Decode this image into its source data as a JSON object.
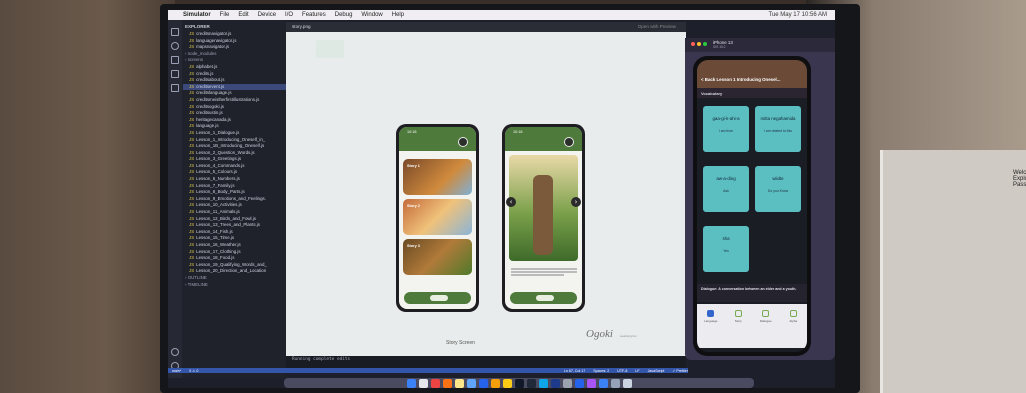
{
  "menubar": {
    "app": "Simulator",
    "items": [
      "File",
      "Edit",
      "Device",
      "I/O",
      "Features",
      "Debug",
      "Window",
      "Help"
    ],
    "clock": "Tue May 17 10:56 AM"
  },
  "explorer": {
    "title": "EXPLORER",
    "files": [
      {
        "kind": "file",
        "label": "creditsnavigator.js"
      },
      {
        "kind": "file",
        "label": "languagenavigator.js"
      },
      {
        "kind": "file",
        "label": "mapsnavigator.js"
      },
      {
        "kind": "folder",
        "label": "node_modules"
      },
      {
        "kind": "folder",
        "label": "screens"
      },
      {
        "kind": "file",
        "label": "alphabet.js"
      },
      {
        "kind": "file",
        "label": "credits.js"
      },
      {
        "kind": "file",
        "label": "creditsabout.js"
      },
      {
        "kind": "file",
        "label": "creditsevent.js",
        "selected": true
      },
      {
        "kind": "file",
        "label": "creditslanguage.js"
      },
      {
        "kind": "file",
        "label": "creditsmeistherfirstillustrations.js"
      },
      {
        "kind": "file",
        "label": "creditsogoki.js"
      },
      {
        "kind": "file",
        "label": "creditsustin.js"
      },
      {
        "kind": "file",
        "label": "heritagecanada.js"
      },
      {
        "kind": "file",
        "label": "language.js"
      },
      {
        "kind": "file",
        "label": "Lesson_1_Dialogue.js"
      },
      {
        "kind": "file",
        "label": "Lesson_1_Introducing_Oneself_in_"
      },
      {
        "kind": "file",
        "label": "Lesson_1B_Introducing_Oneself.js"
      },
      {
        "kind": "file",
        "label": "Lesson_2_Question_Words.js"
      },
      {
        "kind": "file",
        "label": "Lesson_3_Greetings.js"
      },
      {
        "kind": "file",
        "label": "Lesson_4_Commands.js"
      },
      {
        "kind": "file",
        "label": "Lesson_5_Colours.js"
      },
      {
        "kind": "file",
        "label": "Lesson_6_Numbers.js"
      },
      {
        "kind": "file",
        "label": "Lesson_7_Family.js"
      },
      {
        "kind": "file",
        "label": "Lesson_8_Body_Parts.js"
      },
      {
        "kind": "file",
        "label": "Lesson_9_Emotions_and_Feelings."
      },
      {
        "kind": "file",
        "label": "Lesson_10_Activities.js"
      },
      {
        "kind": "file",
        "label": "Lesson_11_Animals.js"
      },
      {
        "kind": "file",
        "label": "Lesson_12_Birds_and_Fowl.js"
      },
      {
        "kind": "file",
        "label": "Lesson_13_Trees_and_Plants.js"
      },
      {
        "kind": "file",
        "label": "Lesson_14_Fish.js"
      },
      {
        "kind": "file",
        "label": "Lesson_15_Time.js"
      },
      {
        "kind": "file",
        "label": "Lesson_16_Weather.js"
      },
      {
        "kind": "file",
        "label": "Lesson_17_Clothing.js"
      },
      {
        "kind": "file",
        "label": "Lesson_18_Food.js"
      },
      {
        "kind": "file",
        "label": "Lesson_19_Qualifying_Words_and_"
      },
      {
        "kind": "file",
        "label": "Lesson_20_Direction_and_Location"
      },
      {
        "kind": "folder",
        "label": "OUTLINE"
      },
      {
        "kind": "folder",
        "label": "TIMELINE"
      }
    ]
  },
  "terminal": {
    "line": "Running complete edits"
  },
  "statusbar": {
    "branch": "main*",
    "errors": "0 ⚠ 0",
    "position": "Ln 67, Col 17",
    "spaces": "Spaces: 2",
    "encoding": "UTF-8",
    "eol": "LF",
    "lang": "JavaScript",
    "prettier": "✓ Prettier"
  },
  "viewer": {
    "tab": "story.png",
    "open_with": "Open with Preview",
    "stories": [
      "Story 1",
      "Story 2",
      "Story 3"
    ],
    "phone_time": "10:18",
    "caption": "Story Screen",
    "brand": "Ogoki",
    "brand_sub": "Learning Inc."
  },
  "simulator": {
    "device": "iPhone 13",
    "os": "iOS 15.2",
    "nav_title": "< Back  Lesson 1 Introducing Onesel...",
    "section": "Vocabulary",
    "cards": [
      {
        "word": "gaa-gi-k-ahi-a",
        "translation": "I am from"
      },
      {
        "word": "mitta negahamida",
        "translation": "I am related to this"
      },
      {
        "word": "aw-a-ding",
        "translation": "Ask"
      },
      {
        "word": "wiidte",
        "translation": "Do you Know"
      },
      {
        "word": "sha",
        "translation": "Yes"
      }
    ],
    "dialogue": "Dialogue: A conversation between an elder and a youth.",
    "tabs": [
      "Language",
      "Story",
      "Dialogue",
      "Alpha"
    ]
  },
  "right_panel": {
    "text": "Welc Explorer Passw"
  }
}
